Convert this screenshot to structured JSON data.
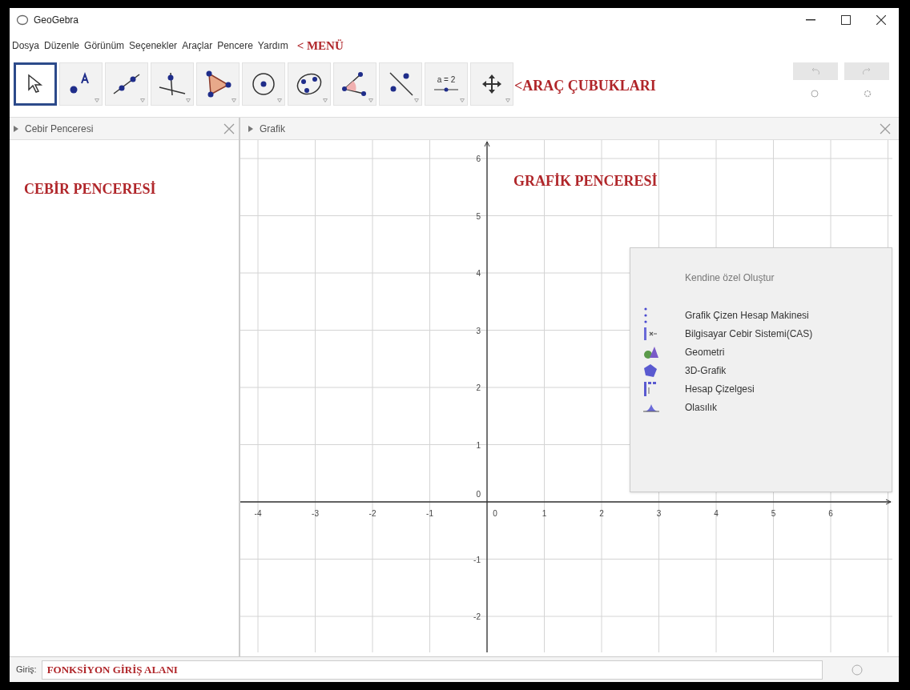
{
  "window": {
    "title": "GeoGebra"
  },
  "menu": [
    "Dosya",
    "Düzenle",
    "Görünüm",
    "Seçenekler",
    "Araçlar",
    "Pencere",
    "Yardım"
  ],
  "menu_annotation": "< MENÜ",
  "toolbar": {
    "tools": [
      {
        "kind": "move",
        "selected": true
      },
      {
        "kind": "point",
        "selected": false
      },
      {
        "kind": "line",
        "selected": false
      },
      {
        "kind": "perpendicular",
        "selected": false
      },
      {
        "kind": "polygon",
        "selected": false
      },
      {
        "kind": "circle",
        "selected": false
      },
      {
        "kind": "conic",
        "selected": false
      },
      {
        "kind": "angle",
        "selected": false
      },
      {
        "kind": "reflect",
        "selected": false
      },
      {
        "kind": "slider",
        "selected": false,
        "label": "a = 2"
      },
      {
        "kind": "move_view",
        "selected": false
      }
    ],
    "annotation": "<ARAÇ ÇUBUKLARI",
    "undo": {
      "disabled": true
    },
    "redo": {
      "disabled": true
    }
  },
  "algebra_view": {
    "title": "Cebir Penceresi",
    "annotation": "CEBİR PENCERESİ"
  },
  "graphics_view": {
    "title": "Grafik",
    "annotation": "GRAFİK PENCERESİ",
    "x_ticks": [
      "-4",
      "-3",
      "-2",
      "-1",
      "0",
      "1",
      "2",
      "3",
      "4",
      "5",
      "6"
    ],
    "y_ticks": [
      "6",
      "5",
      "4",
      "3",
      "2",
      "1",
      "0",
      "-1",
      "-2"
    ],
    "perspectives": {
      "heading": "Kendine özel Oluştur",
      "items": [
        {
          "kind": "graphing",
          "label": "Grafik Çizen Hesap Makinesi"
        },
        {
          "kind": "cas",
          "label": "Bilgisayar Cebir Sistemi(CAS)"
        },
        {
          "kind": "geometry",
          "label": "Geometri"
        },
        {
          "kind": "spatial",
          "label": "3D-Grafik"
        },
        {
          "kind": "spreadsheet",
          "label": "Hesap Çizelgesi"
        },
        {
          "kind": "probability",
          "label": "Olasılık"
        }
      ]
    }
  },
  "input_bar": {
    "label": "Giriş:",
    "value": "FONKSİYON GİRİŞ ALANI"
  }
}
